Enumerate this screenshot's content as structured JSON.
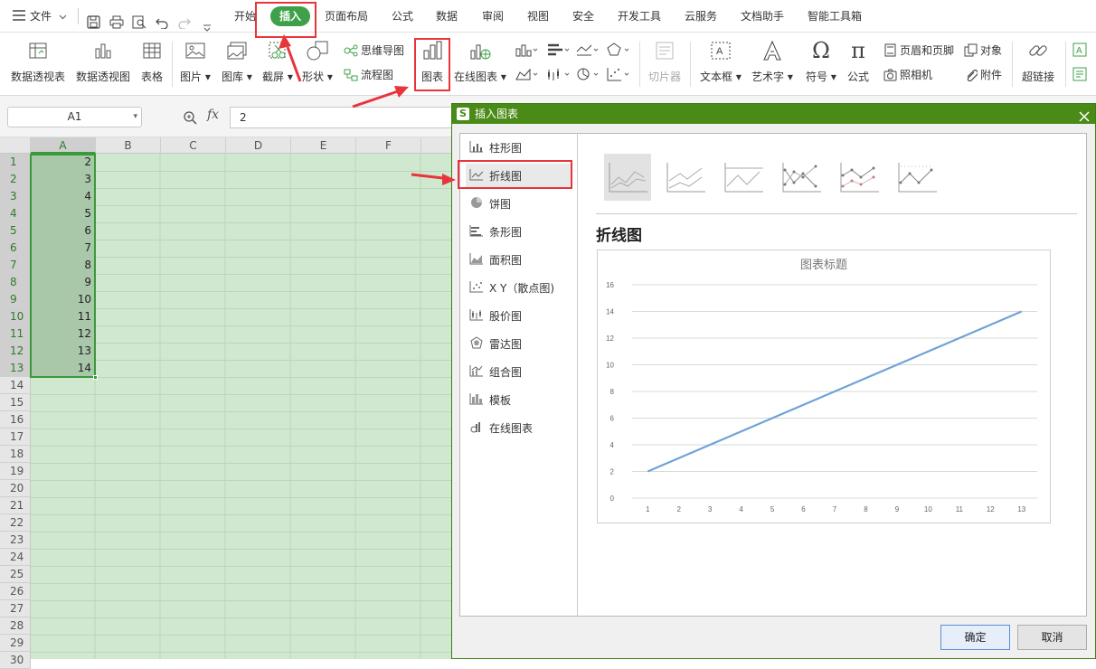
{
  "menubar": {
    "file_label": "文件",
    "tabs": [
      "开始",
      "插入",
      "页面布局",
      "公式",
      "数据",
      "审阅",
      "视图",
      "安全",
      "开发工具",
      "云服务",
      "文档助手",
      "智能工具箱"
    ]
  },
  "ribbon": {
    "pivot_table": "数据透视表",
    "pivot_chart": "数据透视图",
    "table": "表格",
    "picture": "图片",
    "gallery": "图库",
    "screenshot": "截屏",
    "shapes": "形状",
    "mindmap": "思维导图",
    "flowchart": "流程图",
    "chart": "图表",
    "online_chart": "在线图表",
    "slicer": "切片器",
    "textbox": "文本框",
    "wordart": "艺术字",
    "symbol": "符号",
    "equation": "公式",
    "header_footer": "页眉和页脚",
    "camera": "照相机",
    "object": "对象",
    "attachment": "附件",
    "hyperlink": "超链接"
  },
  "formula_bar": {
    "cell_ref": "A1",
    "fx_label": "fx",
    "value": "2"
  },
  "sheet": {
    "columns": [
      "A",
      "B",
      "C",
      "D",
      "E",
      "F"
    ],
    "rows": [
      "1",
      "2",
      "3",
      "4",
      "5",
      "6",
      "7",
      "8",
      "9",
      "10",
      "11",
      "12",
      "13",
      "14",
      "15",
      "16",
      "17",
      "18",
      "19",
      "20",
      "21",
      "22",
      "23",
      "24",
      "25",
      "26",
      "27",
      "28",
      "29",
      "30"
    ],
    "column_a_values": [
      "2",
      "3",
      "4",
      "5",
      "6",
      "7",
      "8",
      "9",
      "10",
      "11",
      "12",
      "13",
      "14"
    ]
  },
  "dialog": {
    "title": "插入图表",
    "categories": [
      "柱形图",
      "折线图",
      "饼图",
      "条形图",
      "面积图",
      "X Y（散点图)",
      "股价图",
      "雷达图",
      "组合图",
      "模板",
      "在线图表"
    ],
    "selected_category": "折线图",
    "preview_heading": "折线图",
    "ok_label": "确定",
    "cancel_label": "取消"
  },
  "chart_data": {
    "type": "line",
    "title": "图表标题",
    "x": [
      1,
      2,
      3,
      4,
      5,
      6,
      7,
      8,
      9,
      10,
      11,
      12,
      13
    ],
    "series": [
      {
        "values": [
          2,
          3,
          4,
          5,
          6,
          7,
          8,
          9,
          10,
          11,
          12,
          13,
          14
        ]
      }
    ],
    "ylim": [
      0,
      16
    ],
    "yticks": [
      0,
      2,
      4,
      6,
      8,
      10,
      12,
      14,
      16
    ],
    "grid": true,
    "line_color": "#6fa3d6"
  },
  "colors": {
    "accent_green": "#4a8a17",
    "active_tab_bg": "#3fa04a",
    "highlight_red": "#e8343b",
    "selection_green": "#cfe8cf"
  }
}
